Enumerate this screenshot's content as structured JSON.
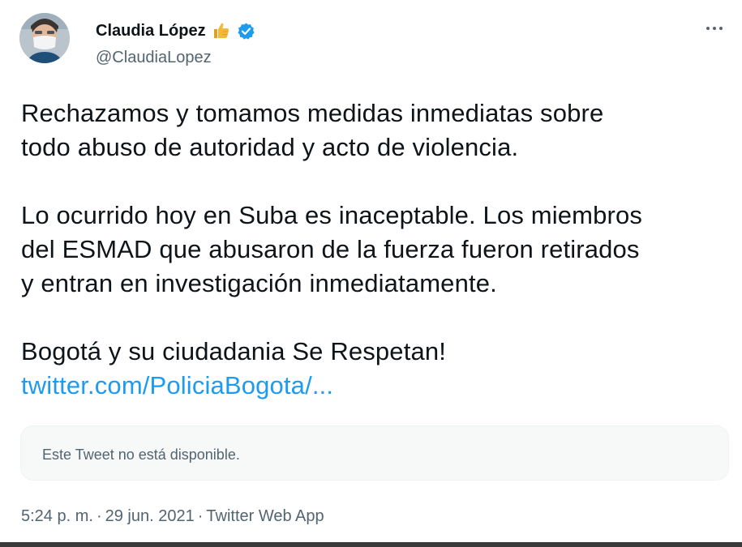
{
  "tweet": {
    "author": {
      "display_name": "Claudia López",
      "handle": "@ClaudiaLopez",
      "avatar_icon": "avatar-photo",
      "emoji_icon": "thumbs-up-icon",
      "verified_icon": "verified-badge-icon"
    },
    "more_icon": "more-options-icon",
    "text_lines": {
      "l1": "Rechazamos y tomamos medidas inmediatas sobre",
      "l2": "todo abuso de autoridad y acto de violencia.",
      "l3": "Lo ocurrido hoy en Suba es inaceptable. Los miembros",
      "l4": "del ESMAD que abusaron de la fuerza fueron retirados",
      "l5": "y entran en investigación inmediatamente.",
      "l6": "Bogotá y su ciudadania Se Respetan!"
    },
    "link_text": "twitter.com/PoliciaBogota/...",
    "quote_unavailable": "Este Tweet no está disponible.",
    "time": "5:24 p. m.",
    "separator": "·",
    "date": "29 jun. 2021",
    "source": "Twitter Web App"
  },
  "colors": {
    "text": "#0f1419",
    "secondary": "#536471",
    "link": "#1d9bf0",
    "verified": "#1d9bf0",
    "thumb": "#f5b93a",
    "quote_bg": "#f7f9f9"
  }
}
